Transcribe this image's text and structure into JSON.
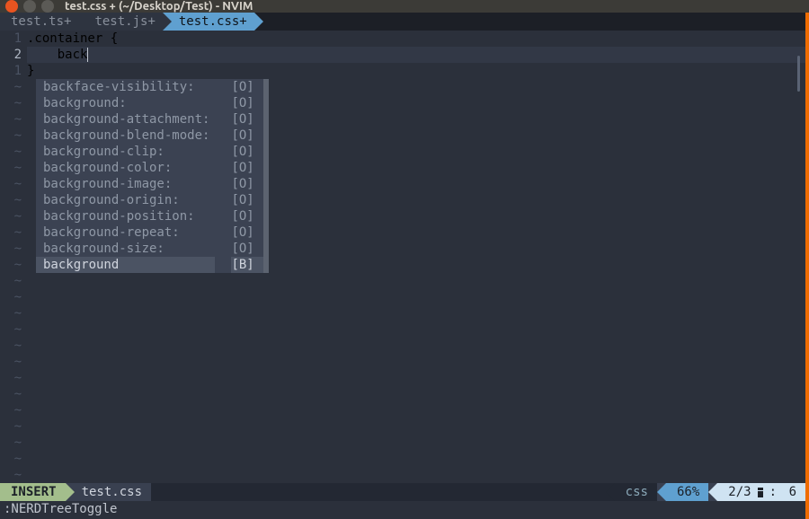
{
  "window": {
    "title": "test.css + (~/Desktop/Test) - NVIM"
  },
  "tabs": [
    {
      "label": "test.ts+",
      "active": false
    },
    {
      "label": "test.js+",
      "active": false
    },
    {
      "label": "test.css+",
      "active": true
    }
  ],
  "code": {
    "lines": [
      {
        "num": "1",
        "text": ".container {",
        "current": false
      },
      {
        "num": "2",
        "text": "    back",
        "current": true,
        "cursor_after": true
      },
      {
        "num": "1",
        "text": "}",
        "current": false
      }
    ],
    "typed": "back"
  },
  "completions": [
    {
      "name": "backface-visibility:",
      "kind": "[O]"
    },
    {
      "name": "background:",
      "kind": "[O]"
    },
    {
      "name": "background-attachment:",
      "kind": "[O]"
    },
    {
      "name": "background-blend-mode:",
      "kind": "[O]"
    },
    {
      "name": "background-clip:",
      "kind": "[O]"
    },
    {
      "name": "background-color:",
      "kind": "[O]"
    },
    {
      "name": "background-image:",
      "kind": "[O]"
    },
    {
      "name": "background-origin:",
      "kind": "[O]"
    },
    {
      "name": "background-position:",
      "kind": "[O]"
    },
    {
      "name": "background-repeat:",
      "kind": "[O]"
    },
    {
      "name": "background-size:",
      "kind": "[O]"
    },
    {
      "name": "background",
      "kind": "[B]"
    }
  ],
  "status": {
    "mode": "INSERT",
    "filename": "test.css",
    "filetype": "css",
    "percent": "66%",
    "line": "2/3",
    "col_label": ":",
    "col": "6"
  },
  "cmdline": ":NERDTreeToggle",
  "tilde": "~"
}
